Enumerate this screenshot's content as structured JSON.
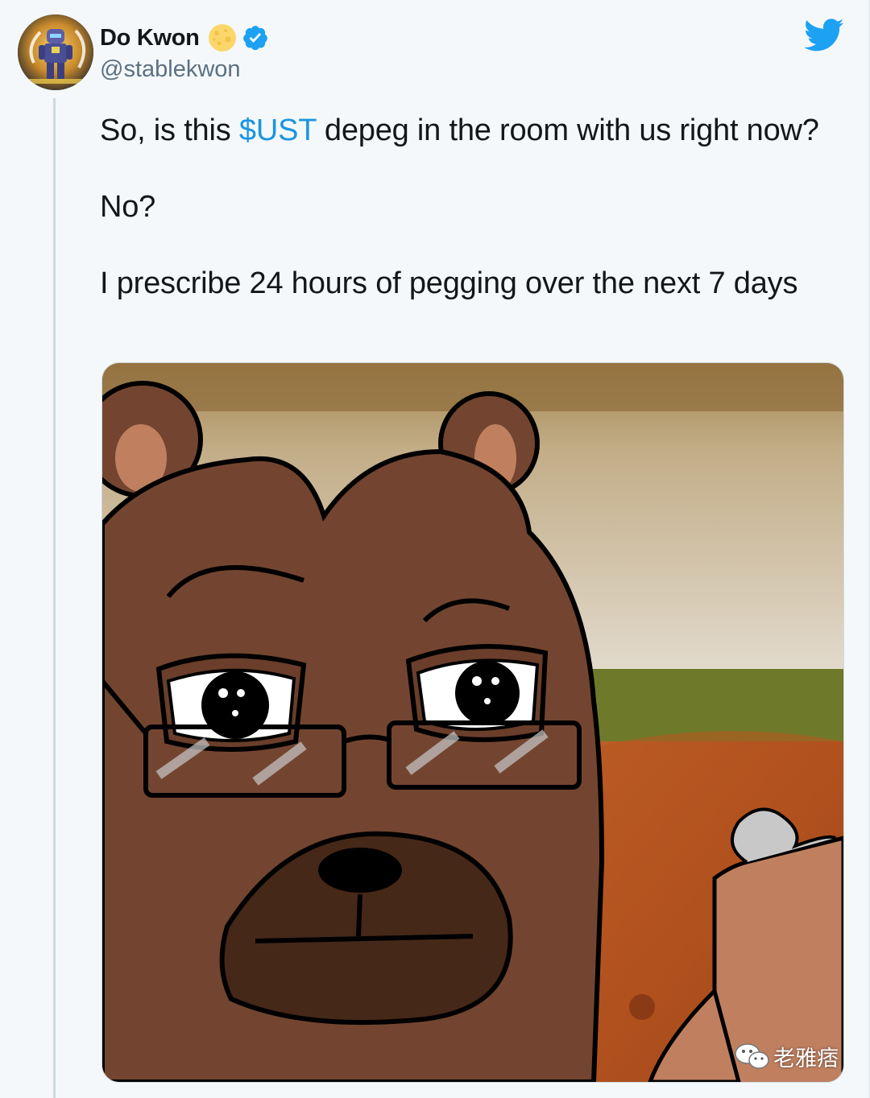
{
  "tweet": {
    "author": {
      "display_name": "Do Kwon",
      "handle": "@stablekwon",
      "badges": [
        "moon-icon",
        "verified-icon"
      ]
    },
    "text": {
      "line1_before": "So, is this ",
      "cashtag": "$UST",
      "line1_after": " depeg in the room with us right now?",
      "line2": "No?",
      "line3": "I prescribe 24 hours of pegging over the next 7 days"
    },
    "media": {
      "watermark": "老雅痞"
    }
  },
  "colors": {
    "link": "#1b95e0",
    "twitter_blue": "#1da1f2",
    "text": "#14171a",
    "secondary": "#5b7083"
  }
}
